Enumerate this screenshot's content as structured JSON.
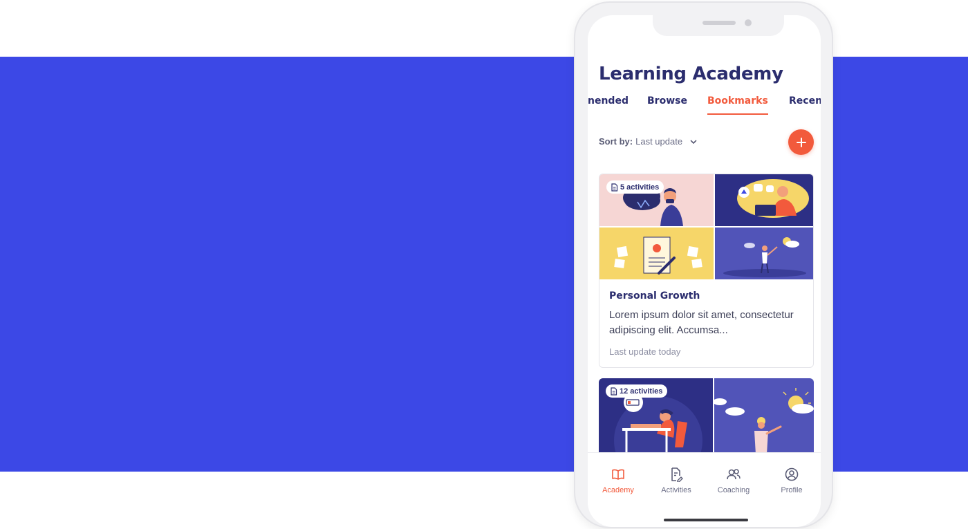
{
  "colors": {
    "band": "#3c48e6",
    "accent": "#f25a3c",
    "navy": "#2b2d6e",
    "pink": "#f6d6d4",
    "yellow": "#f6d669",
    "indigo": "#3a3d98",
    "violet": "#5154b8"
  },
  "app": {
    "title": "Learning Academy"
  },
  "tabs": [
    {
      "label": "nended",
      "active": false
    },
    {
      "label": "Browse",
      "active": false
    },
    {
      "label": "Bookmarks",
      "active": true
    },
    {
      "label": "Recent",
      "active": false
    }
  ],
  "sort": {
    "label": "Sort by:",
    "value": "Last update",
    "icon": "chevron-down-icon"
  },
  "fab": {
    "icon": "plus-icon"
  },
  "cards": [
    {
      "badge": "5 activities",
      "title": "Personal Growth",
      "description": "Lorem ipsum dolor sit amet, consectetur adipiscing elit. Accumsa...",
      "meta": "Last update today"
    },
    {
      "badge": "12 activities"
    }
  ],
  "bottom_nav": [
    {
      "label": "Academy",
      "icon": "book-open-icon",
      "active": true
    },
    {
      "label": "Activities",
      "icon": "document-edit-icon",
      "active": false
    },
    {
      "label": "Coaching",
      "icon": "users-icon",
      "active": false
    },
    {
      "label": "Profile",
      "icon": "user-circle-icon",
      "active": false
    }
  ]
}
